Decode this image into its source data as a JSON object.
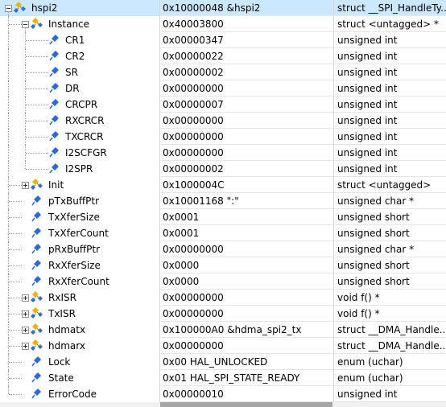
{
  "watch": {
    "rows": [
      {
        "name": "hspi2",
        "value": "0x10000048 &hspi2",
        "type": "struct __SPI_HandleTy...",
        "icon": "struct-icon",
        "expander": "minus",
        "level": 0
      },
      {
        "name": "Instance",
        "value": "0x40003800",
        "type": "struct <untagged> *",
        "icon": "struct-icon",
        "expander": "minus",
        "level": 1
      },
      {
        "name": "CR1",
        "value": "0x00000347",
        "type": "unsigned int",
        "icon": "variable-icon",
        "expander": "",
        "level": 2
      },
      {
        "name": "CR2",
        "value": "0x00000022",
        "type": "unsigned int",
        "icon": "variable-icon",
        "expander": "",
        "level": 2
      },
      {
        "name": "SR",
        "value": "0x00000002",
        "type": "unsigned int",
        "icon": "variable-icon",
        "expander": "",
        "level": 2
      },
      {
        "name": "DR",
        "value": "0x00000000",
        "type": "unsigned int",
        "icon": "variable-icon",
        "expander": "",
        "level": 2
      },
      {
        "name": "CRCPR",
        "value": "0x00000007",
        "type": "unsigned int",
        "icon": "variable-icon",
        "expander": "",
        "level": 2
      },
      {
        "name": "RXCRCR",
        "value": "0x00000000",
        "type": "unsigned int",
        "icon": "variable-icon",
        "expander": "",
        "level": 2
      },
      {
        "name": "TXCRCR",
        "value": "0x00000000",
        "type": "unsigned int",
        "icon": "variable-icon",
        "expander": "",
        "level": 2
      },
      {
        "name": "I2SCFGR",
        "value": "0x00000000",
        "type": "unsigned int",
        "icon": "variable-icon",
        "expander": "",
        "level": 2
      },
      {
        "name": "I2SPR",
        "value": "0x00000002",
        "type": "unsigned int",
        "icon": "variable-icon",
        "expander": "",
        "level": 2
      },
      {
        "name": "Init",
        "value": "0x1000004C",
        "type": "struct <untagged>",
        "icon": "struct-icon",
        "expander": "plus",
        "level": 1
      },
      {
        "name": "pTxBuffPtr",
        "value": "0x10001168 \":\"",
        "type": "unsigned char *",
        "icon": "variable-icon",
        "expander": "",
        "level": 1
      },
      {
        "name": "TxXferSize",
        "value": "0x0001",
        "type": "unsigned short",
        "icon": "variable-icon",
        "expander": "",
        "level": 1
      },
      {
        "name": "TxXferCount",
        "value": "0x0001",
        "type": "unsigned short",
        "icon": "variable-icon",
        "expander": "",
        "level": 1
      },
      {
        "name": "pRxBuffPtr",
        "value": "0x00000000",
        "type": "unsigned char *",
        "icon": "variable-icon",
        "expander": "",
        "level": 1
      },
      {
        "name": "RxXferSize",
        "value": "0x0000",
        "type": "unsigned short",
        "icon": "variable-icon",
        "expander": "",
        "level": 1
      },
      {
        "name": "RxXferCount",
        "value": "0x0000",
        "type": "unsigned short",
        "icon": "variable-icon",
        "expander": "",
        "level": 1
      },
      {
        "name": "RxISR",
        "value": "0x00000000",
        "type": "void f()  *",
        "icon": "struct-icon",
        "expander": "plus",
        "level": 1
      },
      {
        "name": "TxISR",
        "value": "0x00000000",
        "type": "void f()  *",
        "icon": "struct-icon",
        "expander": "plus",
        "level": 1
      },
      {
        "name": "hdmatx",
        "value": "0x100000A0 &hdma_spi2_tx",
        "type": "struct __DMA_Handle...",
        "icon": "struct-icon",
        "expander": "plus",
        "level": 1
      },
      {
        "name": "hdmarx",
        "value": "0x00000000",
        "type": "struct __DMA_Handle...",
        "icon": "struct-icon",
        "expander": "plus",
        "level": 1
      },
      {
        "name": "Lock",
        "value": "0x00 HAL_UNLOCKED",
        "type": "enum (uchar)",
        "icon": "variable-icon",
        "expander": "",
        "level": 1
      },
      {
        "name": "State",
        "value": "0x01 HAL_SPI_STATE_READY",
        "type": "enum (uchar)",
        "icon": "variable-icon",
        "expander": "",
        "level": 1
      },
      {
        "name": "ErrorCode",
        "value": "0x00000010",
        "type": "unsigned int",
        "icon": "variable-icon",
        "expander": "",
        "level": 1
      }
    ]
  },
  "colors": {
    "struct_icon_yellow": "#e8b400",
    "struct_icon_blue": "#2f6fd0",
    "variable_icon_blue": "#2a6ad6",
    "selected_row": "#cce8ff"
  }
}
